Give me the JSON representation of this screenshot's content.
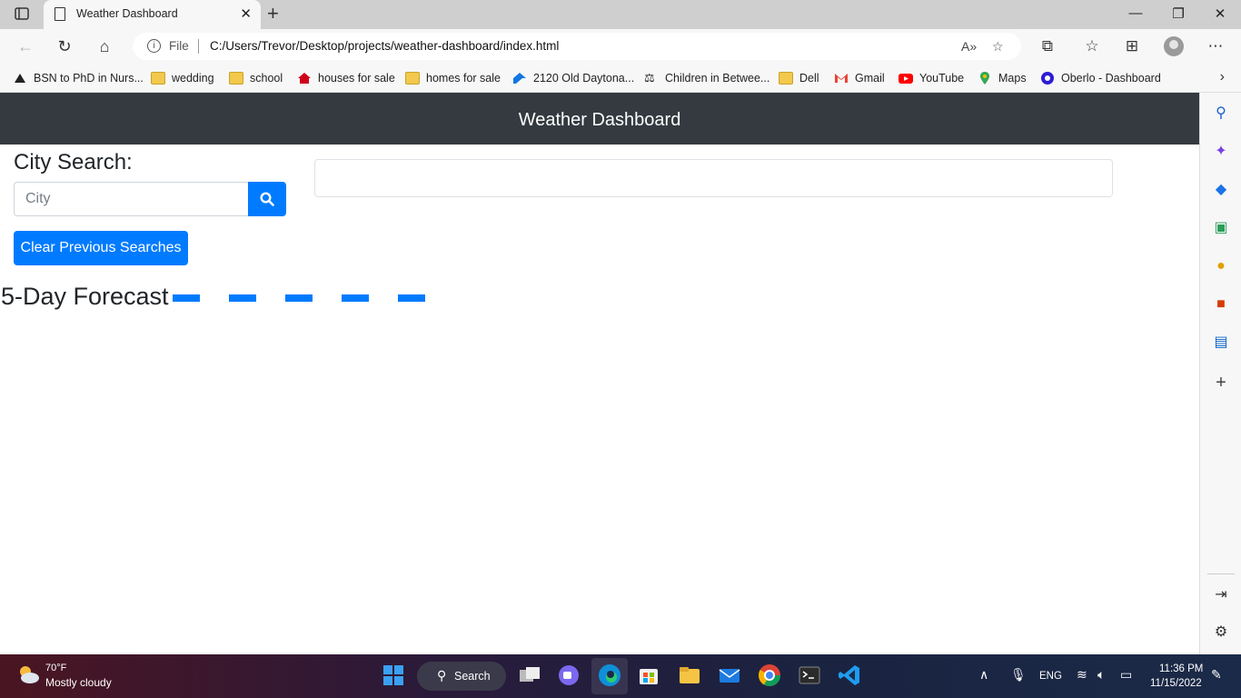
{
  "browser": {
    "tab_title": "Weather Dashboard",
    "omnibox": {
      "scheme_label": "File",
      "url": "C:/Users/Trevor/Desktop/projects/weather-dashboard/index.html"
    },
    "bookmarks": [
      {
        "label": "BSN to PhD in Nurs...",
        "icon": "eagle-icon"
      },
      {
        "label": "wedding",
        "icon": "folder-icon"
      },
      {
        "label": "school",
        "icon": "folder-icon"
      },
      {
        "label": "houses for sale",
        "icon": "house-icon"
      },
      {
        "label": "homes for sale",
        "icon": "folder-icon"
      },
      {
        "label": "2120 Old Daytona...",
        "icon": "zillow-icon"
      },
      {
        "label": "Children in Betwee...",
        "icon": "scales-icon"
      },
      {
        "label": "Dell",
        "icon": "folder-icon"
      },
      {
        "label": "Gmail",
        "icon": "gmail-icon"
      },
      {
        "label": "YouTube",
        "icon": "youtube-icon"
      },
      {
        "label": "Maps",
        "icon": "maps-pin-icon"
      },
      {
        "label": "Oberlo - Dashboard",
        "icon": "oberlo-icon"
      }
    ]
  },
  "app": {
    "header_title": "Weather Dashboard",
    "search_label": "City Search:",
    "city_input": {
      "value": "",
      "placeholder": "City"
    },
    "clear_label": "Clear Previous Searches",
    "forecast_title": "5-Day Forecast",
    "forecast_cards": 5,
    "colors": {
      "primary": "#007bff",
      "header": "#343a40"
    }
  },
  "taskbar": {
    "weather_temp": "70°F",
    "weather_desc": "Mostly cloudy",
    "search_label": "Search",
    "lang": "ENG",
    "time": "11:36 PM",
    "date": "11/15/2022"
  }
}
